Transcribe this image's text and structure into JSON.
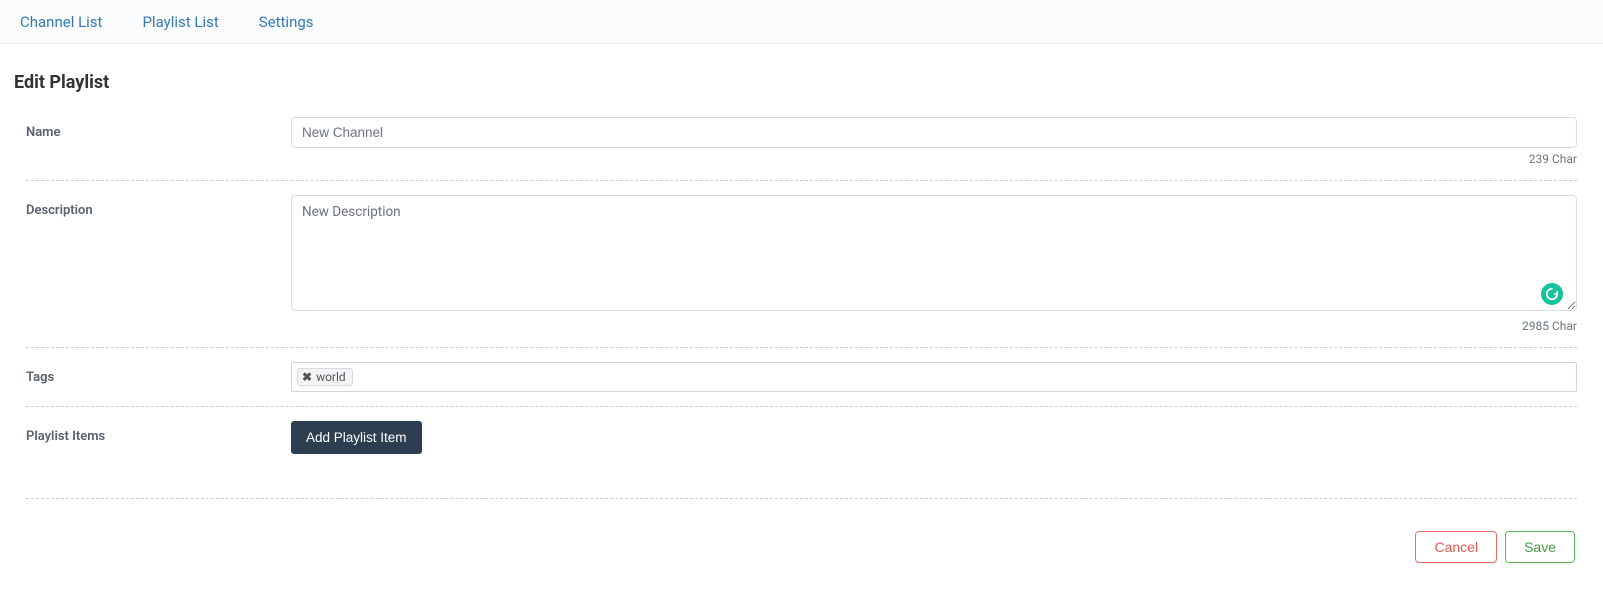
{
  "tabs": {
    "channel_list": "Channel List",
    "playlist_list": "Playlist List",
    "settings": "Settings"
  },
  "page_title": "Edit Playlist",
  "labels": {
    "name": "Name",
    "description": "Description",
    "tags": "Tags",
    "playlist_items": "Playlist Items"
  },
  "fields": {
    "name_value": "New Channel",
    "name_counter": "239 Char",
    "description_value": "New Description",
    "description_counter": "2985 Char"
  },
  "tags": {
    "items": [
      {
        "label": "world"
      }
    ]
  },
  "buttons": {
    "add_playlist_item": "Add Playlist Item",
    "cancel": "Cancel",
    "save": "Save"
  }
}
